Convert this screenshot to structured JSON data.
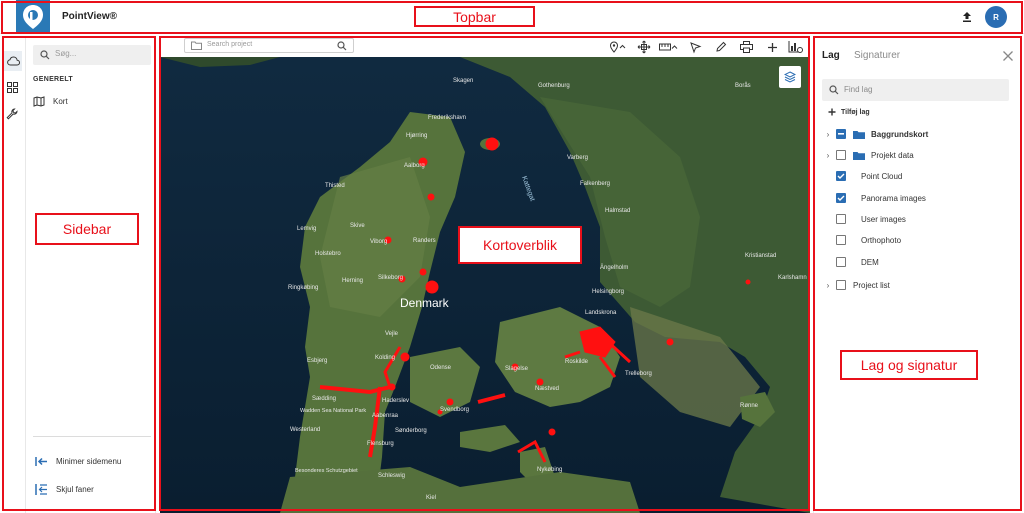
{
  "topbar": {
    "app_name": "PointView®",
    "logo_icon": "pointview-logo",
    "upload_icon": "upload-icon",
    "avatar_initial": "R"
  },
  "rail": {
    "items": [
      {
        "icon": "cloud-icon",
        "active": true
      },
      {
        "icon": "grid-icon"
      },
      {
        "icon": "wrench-icon"
      }
    ]
  },
  "sidebar": {
    "search_placeholder": "Søg...",
    "section_title": "GENERELT",
    "items": [
      {
        "label": "Kort",
        "icon": "map-icon"
      }
    ],
    "minimize_label": "Minimer sidemenu",
    "hide_tabs_label": "Skjul faner"
  },
  "map_toolbar": {
    "search_placeholder": "Search project",
    "tools": [
      "location-pin-icon",
      "move-icon",
      "measure-icon",
      "select-icon",
      "pencil-icon",
      "print-icon",
      "plus-icon",
      "chart-settings-icon"
    ]
  },
  "map": {
    "labels": {
      "country": "Denmark",
      "sea": "Kattegat",
      "cities": [
        "Skagen",
        "Frederikshavn",
        "Hjørring",
        "Aalborg",
        "Gothenburg",
        "Borås",
        "Varberg",
        "Falkenberg",
        "Halmstad",
        "Ängelholm",
        "Helsingborg",
        "Landskrona",
        "Randers",
        "Viborg",
        "Silkeborg",
        "Herning",
        "Holstebro",
        "Lemvig",
        "Ringkøbing",
        "Vejle",
        "Kolding",
        "Esbjerg",
        "Odense",
        "Svendborg",
        "Haderslev",
        "Aabenraa",
        "Sønderborg",
        "Flensburg",
        "Westerland",
        "Schleswig",
        "Kiel",
        "Nykøbing",
        "Næstved",
        "Slagelse",
        "Roskilde",
        "Trelleborg",
        "Kristianstad",
        "Karlshamn",
        "Rønne",
        "Sædding",
        "Skive",
        "Thisted"
      ],
      "parks": [
        "Wadden Sea National Park",
        "Besonderes Schutzgebiet"
      ]
    }
  },
  "right_panel": {
    "tabs": [
      "Lag",
      "Signaturer"
    ],
    "search_placeholder": "Find lag",
    "add_layer_label": "Tilføj lag",
    "layers": [
      {
        "label": "Baggrundskort",
        "bold": true,
        "expandable": true,
        "folder": true,
        "state": "partial"
      },
      {
        "label": "Projekt data",
        "bold": false,
        "expandable": true,
        "folder": true,
        "state": "unchecked"
      },
      {
        "label": "Point Cloud",
        "state": "checked"
      },
      {
        "label": "Panorama images",
        "state": "checked"
      },
      {
        "label": "User images",
        "state": "unchecked"
      },
      {
        "label": "Orthophoto",
        "state": "unchecked"
      },
      {
        "label": "DEM",
        "state": "unchecked"
      },
      {
        "label": "Project list",
        "expandable": true,
        "state": "unchecked"
      }
    ]
  },
  "annotations": {
    "topbar": "Topbar",
    "sidebar": "Sidebar",
    "map": "Kortoverblik",
    "right": "Lag og signatur",
    "color": "#e8101a"
  }
}
